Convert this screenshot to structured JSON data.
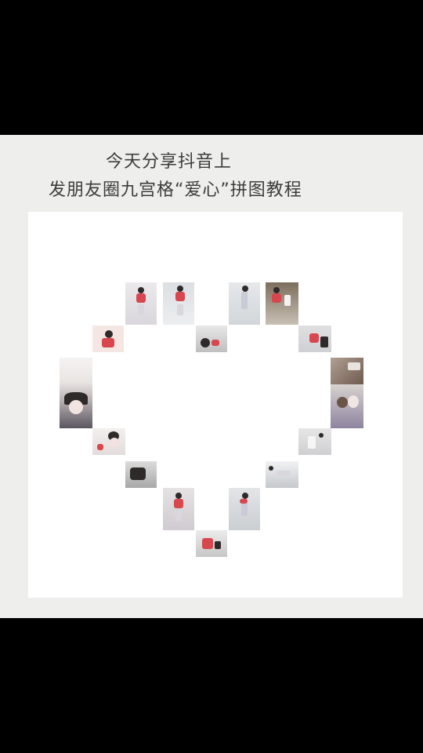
{
  "title": {
    "line1": "今天分享抖音上",
    "line2": "发朋友圈九宫格“爱心”拼图教程"
  },
  "colors": {
    "background_outer": "#000000",
    "stage": "#eeeeec",
    "card": "#ffffff",
    "text": "#3c3c3c",
    "accent_red": "#d8474e"
  },
  "photos": [
    {
      "name": "photo-girl-red-top-1"
    },
    {
      "name": "photo-girl-red-top-2"
    },
    {
      "name": "photo-girl-white-dress-1"
    },
    {
      "name": "photo-couple-1"
    },
    {
      "name": "photo-girl-portrait-1"
    },
    {
      "name": "photo-girl-sitting-1"
    },
    {
      "name": "photo-girl-red-top-3"
    },
    {
      "name": "photo-room-interior"
    },
    {
      "name": "photo-girl-selfie-large"
    },
    {
      "name": "photo-bear-toy"
    },
    {
      "name": "photo-girl-selfie-2"
    },
    {
      "name": "photo-girl-standing-1"
    },
    {
      "name": "photo-girl-bag"
    },
    {
      "name": "photo-street-scene"
    },
    {
      "name": "photo-girl-red-top-4"
    },
    {
      "name": "photo-girl-white-dress-2"
    },
    {
      "name": "photo-girl-sitting-2"
    }
  ]
}
